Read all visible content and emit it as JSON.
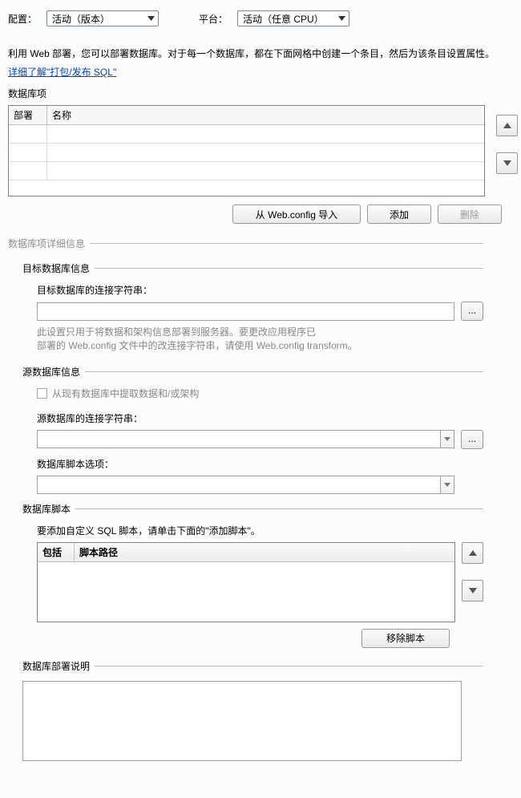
{
  "top": {
    "config_label": "配置：",
    "config_value": "活动（版本）",
    "platform_label": "平台：",
    "platform_value": "活动（任意 CPU）"
  },
  "intro": {
    "para": "利用 Web 部署，您可以部署数据库。对于每一个数据库，都在下面网格中创建一个条目，然后为该条目设置属性。",
    "link": "详细了解\"打包/发布 SQL\""
  },
  "db_entries": {
    "section_label": "数据库项",
    "col_deploy": "部署",
    "col_name": "名称",
    "btn_import": "从 Web.config 导入",
    "btn_add": "添加",
    "btn_remove": "删除"
  },
  "details_header": "数据库项详细信息",
  "dest": {
    "header": "目标数据库信息",
    "conn_label": "目标数据库的连接字符串：",
    "conn_value": "",
    "browse": "...",
    "hint1": "此设置只用于将数据和架构信息部署到服务器。要更改应用程序已",
    "hint2": "部署的 Web.config 文件中的改连接字符串，请使用 Web.config transform。"
  },
  "source": {
    "header": "源数据库信息",
    "chk_label": "从现有数据库中提取数据和/或架构",
    "conn_label": "源数据库的连接字符串：",
    "conn_value": "",
    "browse": "...",
    "script_opt_label": "数据库脚本选项：",
    "script_opt_value": ""
  },
  "scripts": {
    "header": "数据库脚本",
    "hint": "要添加自定义 SQL 脚本，请单击下面的\"添加脚本\"。",
    "col_include": "包括",
    "col_path": "脚本路径",
    "btn_remove": "移除脚本"
  },
  "notes": {
    "header": "数据库部署说明",
    "value": ""
  }
}
